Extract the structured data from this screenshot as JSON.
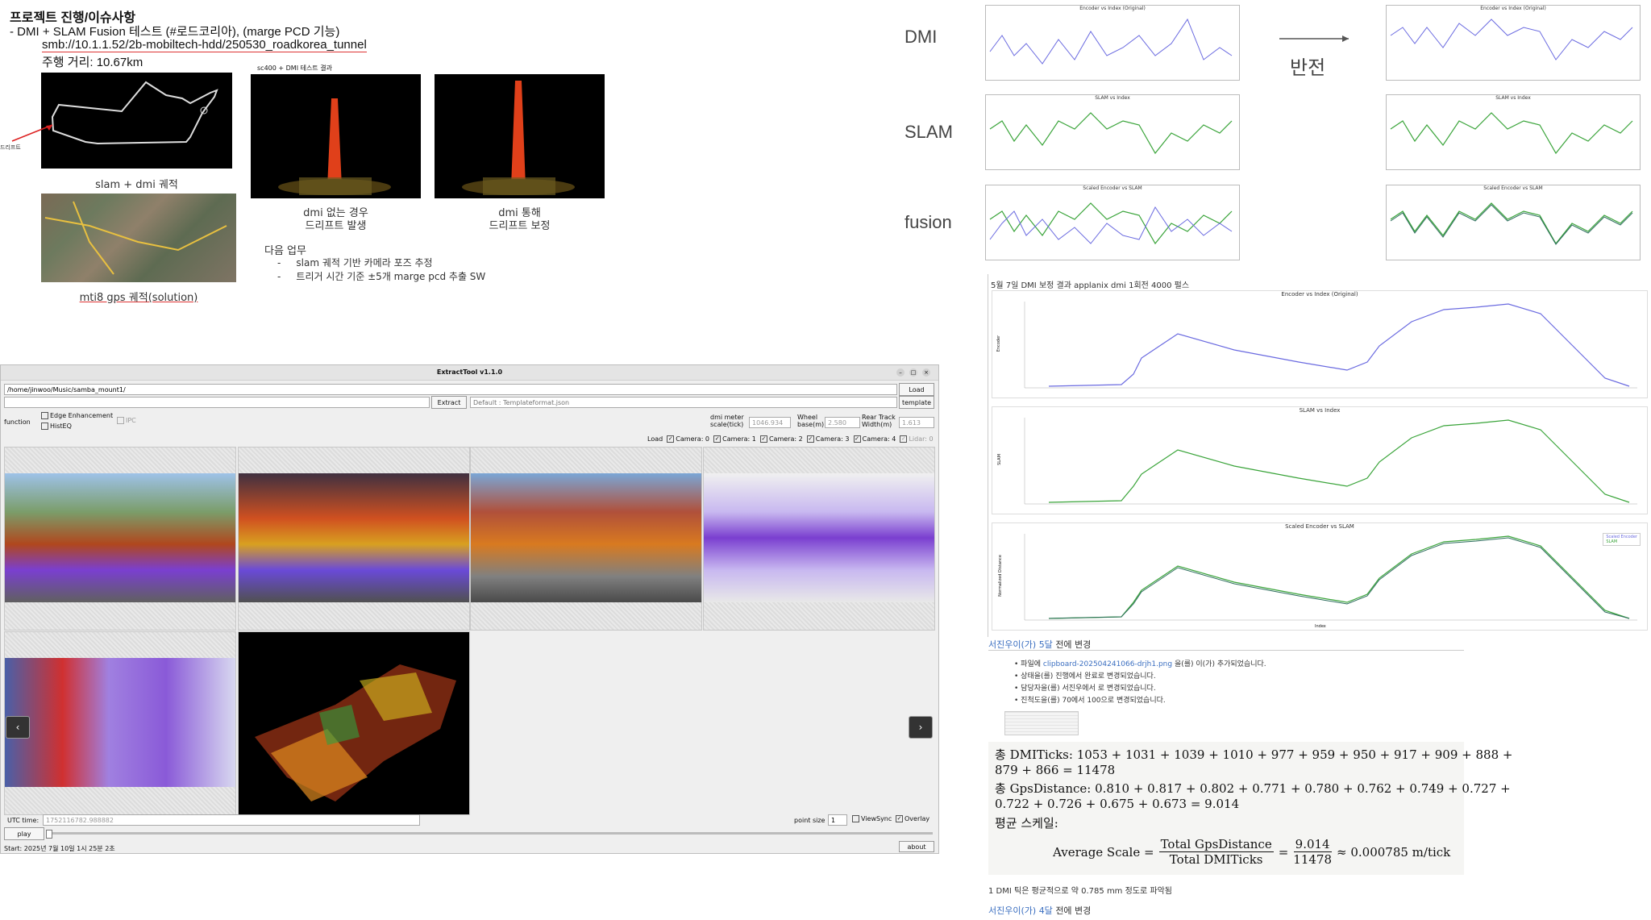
{
  "slide": {
    "title": "프로젝트 진행/이슈사항",
    "bullet_prefix": "-",
    "line1": "DMI + SLAM Fusion 테스트 (#로드코리아), (marge PCD 기능)",
    "line2": "smb://10.1.1.52/2b-mobiltech-hdd/250530_roadkorea_tunnel",
    "line3": "주행 거리: 10.67km",
    "left_cut_label": "드리프트",
    "caption_slam_dmi": "slam + dmi 궤적",
    "caption_gps": "mti8 gps 궤적(solution)",
    "sc400_label": "sc400 + DMI 테스트 결과",
    "caption_no_dmi_1": "dmi 없는 경우",
    "caption_no_dmi_2": "드리프트 발생",
    "caption_dmi_1": "dmi 통해",
    "caption_dmi_2": "드리프트 보정",
    "next_title": "다음 업무",
    "next_items": [
      "slam 궤적 기반 카메라 포즈 추정",
      "트리거 시간 기준 ±5개 marge pcd 추출 SW"
    ]
  },
  "right_panels": {
    "row_labels": [
      "DMI",
      "SLAM",
      "fusion"
    ],
    "arrow_label": "반전",
    "chart_titles_left": [
      "Encoder vs Index (Original)",
      "SLAM vs Index",
      "Scaled Encoder vs SLAM"
    ],
    "chart_titles_right": [
      "Encoder vs Index (Original)",
      "SLAM vs Index",
      "Scaled Encoder vs SLAM"
    ]
  },
  "report": {
    "heading": "5월 7일 DMI 보정 결과 applanix dmi 1회전 4000 펄스",
    "chart_titles": [
      "Encoder vs Index (Original)",
      "SLAM vs Index",
      "Scaled Encoder vs SLAM"
    ],
    "legend": [
      "Scaled Encoder",
      "SLAM"
    ],
    "xlabel": "Index",
    "ylabels": [
      "Encoder",
      "SLAM",
      "Normalized Distance"
    ],
    "change_user_1": "서진우이(가)",
    "change_time_1": "5달",
    "change_suffix_1": "전에 변경",
    "changes": [
      {
        "pre": "파일에 ",
        "link": "clipboard-202504241066-drjh1.png",
        "post": " 을(를) 이(가) 추가되었습니다."
      },
      {
        "pre": "상태을(를) ",
        "link": "",
        "post": "진행에서 완료로 변경되었습니다."
      },
      {
        "pre": "담당자을(를) ",
        "link": "",
        "post": "서진우에서 로 변경되었습니다."
      },
      {
        "pre": "진척도을(를) ",
        "link": "",
        "post": "70에서 100으로 변경되었습니다."
      }
    ],
    "math_line1": "총 DMITicks: 1053 + 1031 + 1039 + 1010 + 977 + 959 + 950 + 917 + 909 + 888 +",
    "math_line2": "879 + 866 = 11478",
    "math_line3": "총 GpsDistance: 0.810 + 0.817 + 0.802 + 0.771 + 0.780 + 0.762 + 0.749 + 0.727 +",
    "math_line4": "0.722 + 0.726 + 0.675 + 0.673 = 9.014",
    "math_line5": "평균 스케일:",
    "formula_lhs": "Average Scale =",
    "formula_num1": "Total GpsDistance",
    "formula_den1": "Total DMITicks",
    "formula_eq": "=",
    "formula_num2": "9.014",
    "formula_den2": "11478",
    "formula_rhs": "≈ 0.000785 m/tick",
    "note": "1 DMI 틱은 평균적으로 약 0.785 mm 정도로 파악됨",
    "change_user_2": "서진우이(가)",
    "change_time_2": "4달",
    "change_suffix_2": "전에 변경"
  },
  "extract_tool": {
    "title": "ExtractTool v1.1.0",
    "path": "/home/jinwoo/Music/samba_mount1/",
    "load_btn": "Load",
    "extract_btn": "Extract",
    "template_placeholder": "Default : Templateformat.json",
    "template_btn": "template",
    "function_label": "function",
    "edge_enh": "Edge Enhancement",
    "histeq": "HistEQ",
    "ipc": "IPC",
    "dmi_meter_label": "dmi meter scale(tick)",
    "dmi_meter_value": "1046.934",
    "wheel_base_label": "Wheel base(m)",
    "wheel_base_value": "2.580",
    "rear_track_label": "Rear Track Width(m)",
    "rear_track_value": "1.613",
    "load_label": "Load",
    "cameras": [
      "Camera: 0",
      "Camera: 1",
      "Camera: 2",
      "Camera: 3",
      "Camera: 4",
      "Lidar: 0"
    ],
    "utc_label": "UTC time:",
    "utc_value": "1752116782.988882",
    "play_btn": "play",
    "point_size_label": "point size",
    "point_size_value": "1",
    "viewsync": "ViewSync",
    "overlay": "Overlay",
    "start_text": "Start: 2025년 7월 10일 1시 25분 2초",
    "about_btn": "about"
  },
  "colors": {
    "encoder_line": "#6a6ae0",
    "slam_line": "#3aa43a",
    "fusion_dark": "#2e6e5e",
    "link": "#3a6ec0",
    "tower_red": "#e0401a"
  },
  "icons": [
    "arrow-right-icon",
    "chevron-left-icon",
    "chevron-right-icon",
    "minimize-icon",
    "maximize-icon",
    "close-icon"
  ]
}
